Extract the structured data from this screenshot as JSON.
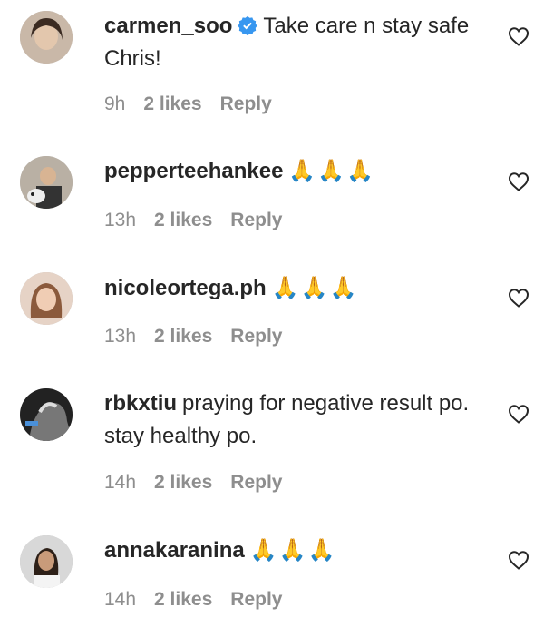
{
  "comments": [
    {
      "username": "carmen_soo",
      "verified": true,
      "text": "Take care n stay safe Chris!",
      "time": "9h",
      "likes": "2 likes",
      "reply": "Reply"
    },
    {
      "username": "pepperteehankee",
      "verified": false,
      "text": "🙏🙏🙏",
      "time": "13h",
      "likes": "2 likes",
      "reply": "Reply"
    },
    {
      "username": "nicoleortega.ph",
      "verified": false,
      "text": "🙏🙏🙏",
      "time": "13h",
      "likes": "2 likes",
      "reply": "Reply"
    },
    {
      "username": "rbkxtiu",
      "verified": false,
      "text": "praying for negative result po. stay healthy po.",
      "time": "14h",
      "likes": "2 likes",
      "reply": "Reply"
    },
    {
      "username": "annakaranina",
      "verified": false,
      "text": "🙏🙏🙏",
      "time": "14h",
      "likes": "2 likes",
      "reply": "Reply"
    }
  ],
  "icons": {
    "like": "heart-outline-icon",
    "verified": "verified-badge-icon"
  },
  "colors": {
    "verified": "#3897f0",
    "meta": "#8e8e8e",
    "text": "#262626"
  }
}
